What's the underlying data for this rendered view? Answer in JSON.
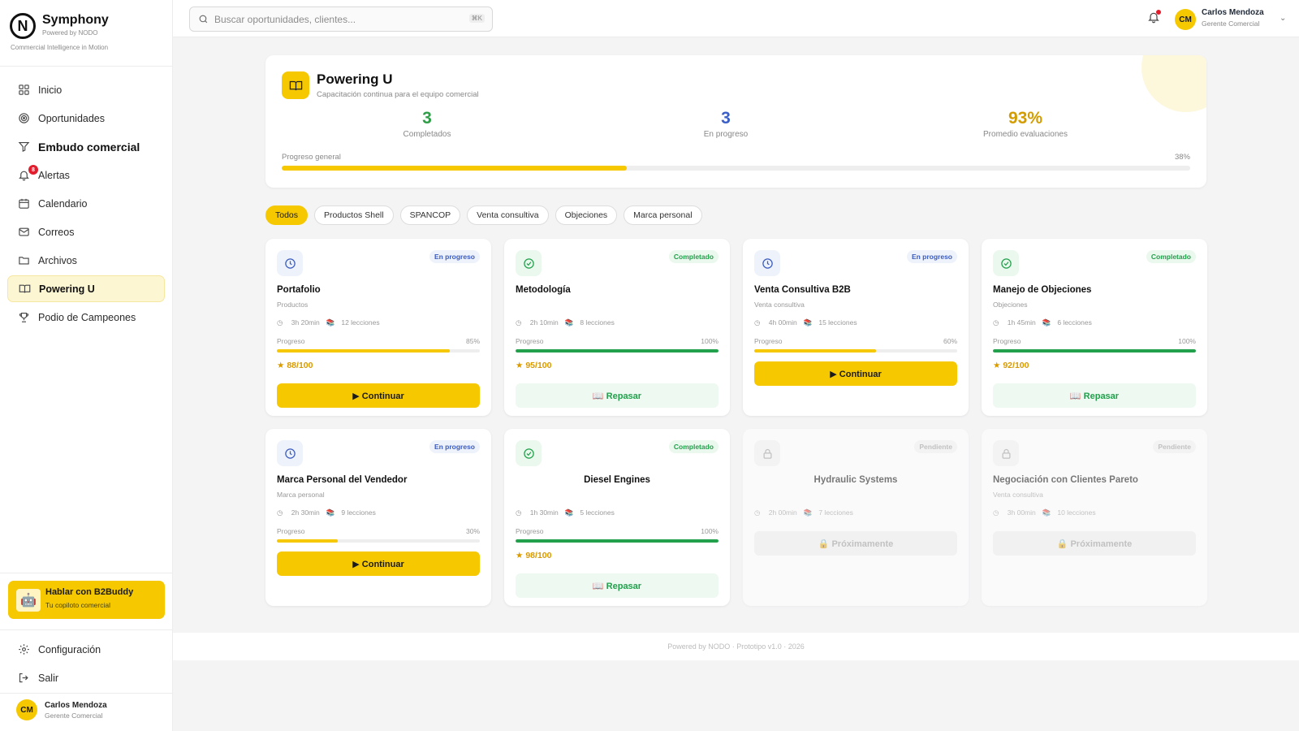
{
  "brand": {
    "logo": "N",
    "name": "Symphony",
    "powered": "Powered by NODO",
    "tagline": "Commercial Intelligence in Motion"
  },
  "nav": [
    {
      "label": "Inicio",
      "icon": "grid-icon"
    },
    {
      "label": "Oportunidades",
      "icon": "target-icon"
    },
    {
      "label": "Embudo comercial",
      "icon": "funnel-icon"
    },
    {
      "label": "Alertas",
      "icon": "bell-icon",
      "badge": "8"
    },
    {
      "label": "Calendario",
      "icon": "calendar-icon"
    },
    {
      "label": "Correos",
      "icon": "mail-icon"
    },
    {
      "label": "Archivos",
      "icon": "folder-icon"
    },
    {
      "label": "Powering U",
      "icon": "book-icon"
    },
    {
      "label": "Podio de Campeones",
      "icon": "trophy-icon"
    }
  ],
  "buddy": {
    "title": "Hablar con B2Buddy",
    "subtitle": "Tu copiloto comercial"
  },
  "bottom_nav": [
    {
      "label": "Configuración",
      "icon": "gear-icon"
    },
    {
      "label": "Salir",
      "icon": "logout-icon"
    }
  ],
  "user": {
    "initials": "CM",
    "name": "Carlos Mendoza",
    "role": "Gerente Comercial"
  },
  "search": {
    "placeholder": "Buscar oportunidades, clientes...",
    "shortcut": "⌘K"
  },
  "hero": {
    "title": "Powering U",
    "subtitle": "Capacitación continua para el equipo comercial",
    "stats": [
      {
        "value": "3",
        "label": "Completados",
        "color": "#2e9e47"
      },
      {
        "value": "3",
        "label": "En progreso",
        "color": "#3a5fc8"
      },
      {
        "value": "93%",
        "label": "Promedio evaluaciones",
        "color": "#d39c00"
      }
    ],
    "progress_label": "Progreso general",
    "progress_pct_text": "38%",
    "progress_value": 0.38
  },
  "filters": [
    "Todos",
    "Productos Shell",
    "SPANCOP",
    "Venta consultiva",
    "Objeciones",
    "Marca personal"
  ],
  "courses": [
    {
      "title": "Portafolio",
      "category": "Productos",
      "duration": "3h 20min",
      "lessons": "12 lecciones",
      "status": "En progreso",
      "state": "prog",
      "progress_label": "Progreso",
      "progress_text": "85%",
      "progress": 0.85,
      "score": "88/100",
      "button": "▶ Continuar"
    },
    {
      "title": "Metodología",
      "category": "",
      "duration": "2h 10min",
      "lessons": "8 lecciones",
      "status": "Completado",
      "state": "done",
      "progress_label": "Progreso",
      "progress_text": "100%",
      "progress": 1.0,
      "score": "95/100",
      "button": "📖 Repasar"
    },
    {
      "title": "Venta Consultiva B2B",
      "category": "Venta consultiva",
      "duration": "4h 00min",
      "lessons": "15 lecciones",
      "status": "En progreso",
      "state": "prog",
      "progress_label": "Progreso",
      "progress_text": "60%",
      "progress": 0.6,
      "score": "",
      "button": "▶ Continuar"
    },
    {
      "title": "Manejo de Objeciones",
      "category": "Objeciones",
      "duration": "1h 45min",
      "lessons": "6 lecciones",
      "status": "Completado",
      "state": "done",
      "progress_label": "Progreso",
      "progress_text": "100%",
      "progress": 1.0,
      "score": "92/100",
      "button": "📖 Repasar"
    },
    {
      "title": "Marca Personal del Vendedor",
      "category": "Marca personal",
      "duration": "2h 30min",
      "lessons": "9 lecciones",
      "status": "En progreso",
      "state": "prog",
      "progress_label": "Progreso",
      "progress_text": "30%",
      "progress": 0.3,
      "score": "",
      "button": "▶ Continuar"
    },
    {
      "title": "Diesel Engines",
      "category": "",
      "duration": "1h 30min",
      "lessons": "5 lecciones",
      "status": "Completado",
      "state": "done",
      "progress_label": "Progreso",
      "progress_text": "100%",
      "progress": 1.0,
      "score": "98/100",
      "button": "📖 Repasar"
    },
    {
      "title": "Hydraulic Systems",
      "category": "",
      "duration": "2h 00min",
      "lessons": "7 lecciones",
      "status": "Pendiente",
      "state": "lock",
      "progress_label": "",
      "progress_text": "",
      "progress": null,
      "score": "",
      "button": "🔒 Próximamente"
    },
    {
      "title": "Negociación con Clientes Pareto",
      "category": "Venta consultiva",
      "duration": "3h 00min",
      "lessons": "10 lecciones",
      "status": "Pendiente",
      "state": "lock",
      "progress_label": "",
      "progress_text": "",
      "progress": null,
      "score": "",
      "button": "🔒 Próximamente"
    }
  ],
  "footer": "Powered by NODO · Prototipo v1.0 · 2026",
  "colors": {
    "accent": "#f5c800",
    "success": "#22a04b",
    "info": "#3b5bbd",
    "danger": "#e11d2e"
  }
}
